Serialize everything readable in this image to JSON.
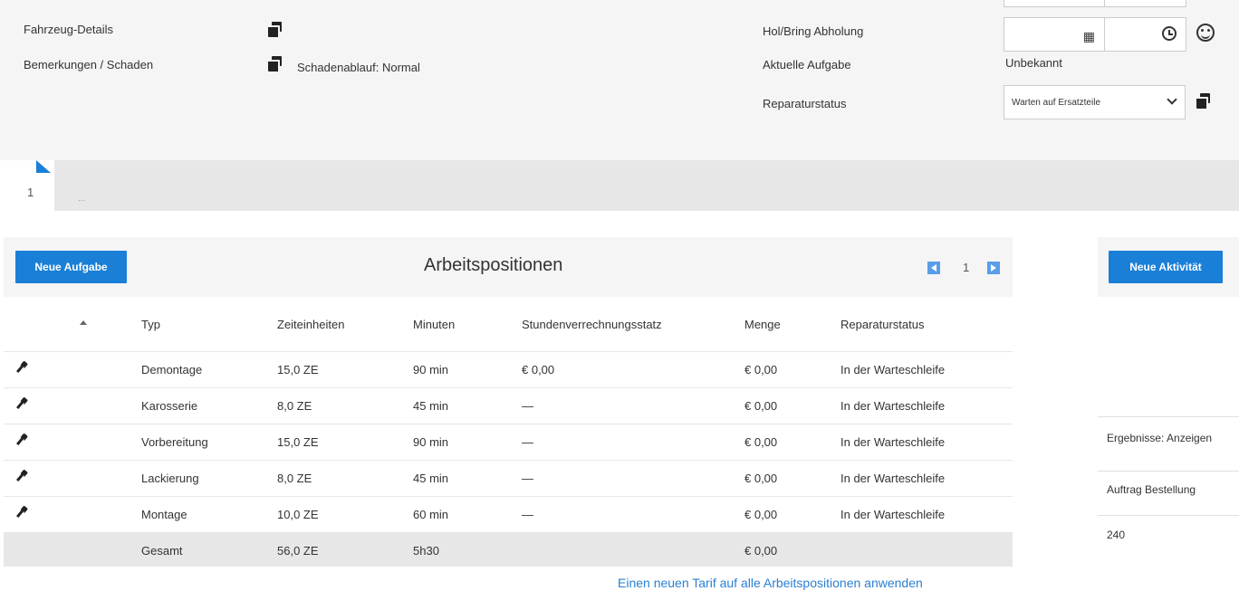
{
  "details": {
    "fahrzeug_label": "Fahrzeug-Details",
    "bemerkungen_label": "Bemerkungen / Schaden",
    "schadenablauf_text": "Schadenablauf: Normal",
    "holbring_label": "Hol/Bring Abholung",
    "aufgabe_label": "Aktuelle Aufgabe",
    "aufgabe_value": "Unbekannt",
    "reparaturstatus_label": "Reparaturstatus",
    "reparaturstatus_selected": "Warten auf Ersatzteile"
  },
  "tabs": {
    "number": "1",
    "placeholder": "..."
  },
  "arbeitspositionen": {
    "new_button": "Neue Aufgabe",
    "title": "Arbeitspositionen",
    "page": "1",
    "columns": {
      "typ": "Typ",
      "zeiteinheiten": "Zeiteinheiten",
      "minuten": "Minuten",
      "stundensatz": "Stundenverrechnungsstatz",
      "menge": "Menge",
      "status": "Reparaturstatus"
    },
    "rows": [
      {
        "typ": "Demontage",
        "ze": "15,0 ZE",
        "min": "90 min",
        "satz": "€ 0,00",
        "menge": "€ 0,00",
        "status": "In der Warteschleife"
      },
      {
        "typ": "Karosserie",
        "ze": "8,0 ZE",
        "min": "45 min",
        "satz": "—",
        "menge": "€ 0,00",
        "status": "In der Warteschleife"
      },
      {
        "typ": "Vorbereitung",
        "ze": "15,0 ZE",
        "min": "90 min",
        "satz": "—",
        "menge": "€ 0,00",
        "status": "In der Warteschleife"
      },
      {
        "typ": "Lackierung",
        "ze": "8,0 ZE",
        "min": "45 min",
        "satz": "—",
        "menge": "€ 0,00",
        "status": "In der Warteschleife"
      },
      {
        "typ": "Montage",
        "ze": "10,0 ZE",
        "min": "60 min",
        "satz": "—",
        "menge": "€ 0,00",
        "status": "In der Warteschleife"
      }
    ],
    "total": {
      "typ": "Gesamt",
      "ze": "56,0 ZE",
      "min": "5h30",
      "menge": "€ 0,00"
    },
    "tarif_link": "Einen neuen Tarif auf alle Arbeitspositionen anwenden"
  },
  "aktivitaeten": {
    "new_button": "Neue Aktivität",
    "ergebnisse": "Ergebnisse: Anzeigen",
    "auftrag": "Auftrag Bestellung",
    "value": "240"
  },
  "colors": {
    "accent": "#1a7fd6",
    "link": "#2b7fd1",
    "panel": "#f5f5f5"
  }
}
